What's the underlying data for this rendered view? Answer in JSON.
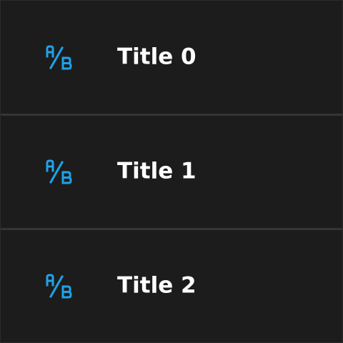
{
  "accent_color": "#1fa3e8",
  "rows": [
    {
      "icon": "ab-test-icon",
      "title": "Title 0"
    },
    {
      "icon": "ab-test-icon",
      "title": "Title 1"
    },
    {
      "icon": "ab-test-icon",
      "title": "Title 2"
    }
  ]
}
